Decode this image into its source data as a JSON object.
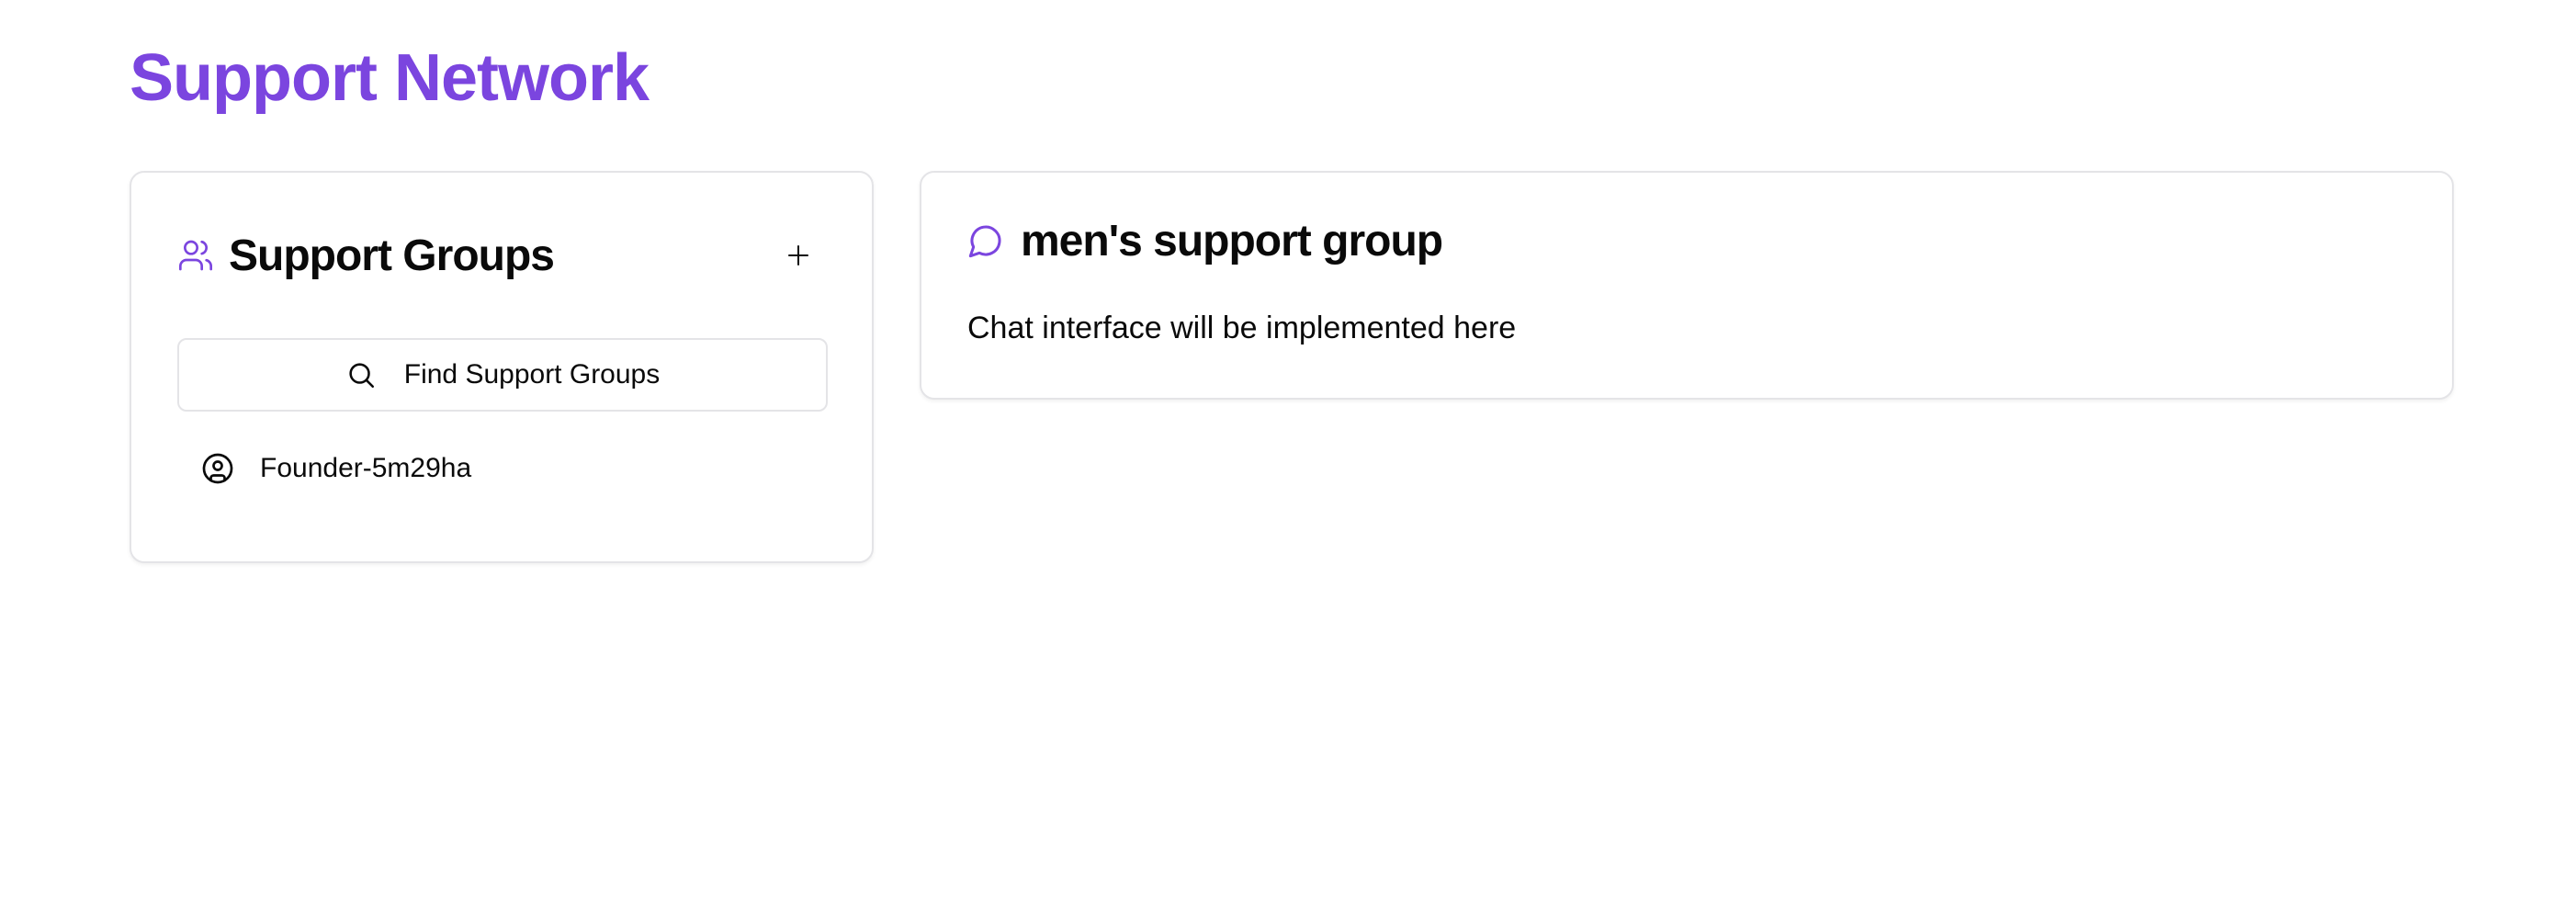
{
  "page": {
    "title": "Support Network",
    "accent_color": "#7b45df"
  },
  "groups_panel": {
    "title": "Support Groups",
    "title_icon": "users-icon",
    "add_icon": "plus-icon",
    "find_button": {
      "icon": "search-icon",
      "label": "Find Support Groups"
    },
    "items": [
      {
        "icon": "circle-user-icon",
        "label": "Founder-5m29ha"
      }
    ]
  },
  "chat_panel": {
    "icon": "message-circle-icon",
    "title": "men's support group",
    "placeholder": "Chat interface will be implemented here"
  }
}
